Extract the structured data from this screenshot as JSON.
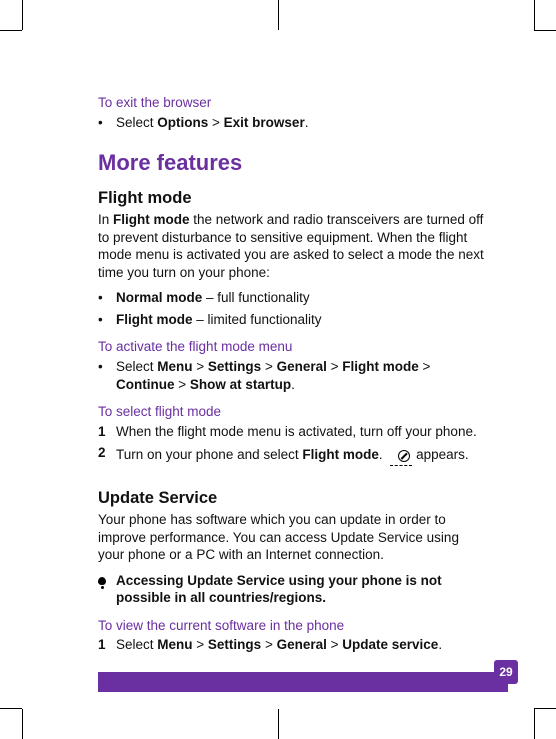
{
  "section1": {
    "heading": "To exit the browser",
    "bullet_prefix": "Select ",
    "options": "Options",
    "sep": " > ",
    "exit": "Exit browser",
    "period": "."
  },
  "more_features": "More features",
  "flight": {
    "heading": "Flight mode",
    "intro_pre": "In ",
    "intro_bold": "Flight mode",
    "intro_post": " the network and radio transceivers are turned off to prevent disturbance to sensitive equipment. When the flight mode menu is activated you are asked to select a mode the next time you turn on your phone:",
    "b1_bold": "Normal mode",
    "b1_post": " – full functionality",
    "b2_bold": "Flight mode",
    "b2_post": " – limited functionality",
    "activate_heading": "To activate the flight mode menu",
    "activate_pre": "Select ",
    "m": "Menu",
    "s": "Settings",
    "g": "General",
    "fm": "Flight mode",
    "c": "Continue",
    "ss": "Show at startup",
    "select_heading": "To select flight mode",
    "step1": "When the flight mode menu is activated, turn off your phone.",
    "step2_pre": "Turn on your phone and select ",
    "step2_bold": "Flight mode",
    "step2_post1": ". ",
    "step2_post2": " appears."
  },
  "update": {
    "heading": "Update Service",
    "intro": "Your phone has software which you can update in order to improve performance. You can access Update Service using your phone or a PC with an Internet connection.",
    "alert": "Accessing Update Service using your phone is not possible in all countries/regions.",
    "view_heading": "To view the current software in the phone",
    "step1_pre": "Select ",
    "m": "Menu",
    "s": "Settings",
    "g": "General",
    "us": "Update service"
  },
  "page_number": "29",
  "gt": " > "
}
